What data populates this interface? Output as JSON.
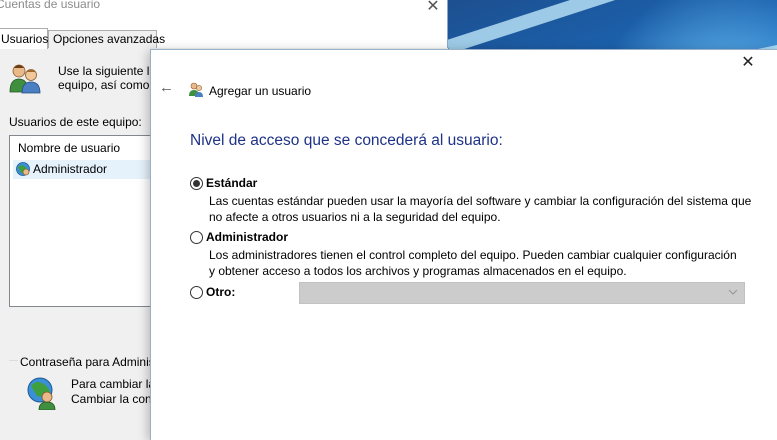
{
  "background_window": {
    "title": "Cuentas de usuario",
    "close_label": "✕",
    "tabs": [
      {
        "label": "Usuarios",
        "selected": true
      },
      {
        "label": "Opciones avanzadas",
        "selected": false
      }
    ],
    "intro_line1": "Use la siguiente li",
    "intro_line2": "equipo, así como",
    "users_label": "Usuarios de este equipo:",
    "list": {
      "column_header": "Nombre de usuario",
      "rows": [
        "Administrador"
      ]
    },
    "password_group_label": "Contraseña para Adminis",
    "password_line1": "Para cambiar la",
    "password_line2": "Cambiar la con"
  },
  "wizard": {
    "close_label": "✕",
    "back_label": "←",
    "title": "Agregar un usuario",
    "heading": "Nivel de acceso que se concederá al usuario:",
    "options": [
      {
        "label": "Estándar",
        "checked": true,
        "desc_line1": "Las cuentas estándar pueden usar la mayoría del software y cambiar la configuración del sistema que",
        "desc_line2": "no afecte a otros usuarios ni a la seguridad del equipo."
      },
      {
        "label": "Administrador",
        "checked": false,
        "desc_line1": "Los administradores tienen el control completo del equipo. Pueden cambiar cualquier configuración",
        "desc_line2": "y obtener acceso a todos los archivos y programas almacenados en el equipo."
      },
      {
        "label": "Otro:",
        "checked": false,
        "select_value": "",
        "select_enabled": false
      }
    ]
  },
  "colors": {
    "heading": "#1e3287",
    "selection": "#e5f1fb",
    "disabled_combo": "#cccccc"
  },
  "icons": [
    "users-icon",
    "user-row-icon",
    "password-user-icon",
    "back-arrow-icon",
    "wizard-users-icon",
    "close-icon",
    "chevron-down-icon"
  ]
}
